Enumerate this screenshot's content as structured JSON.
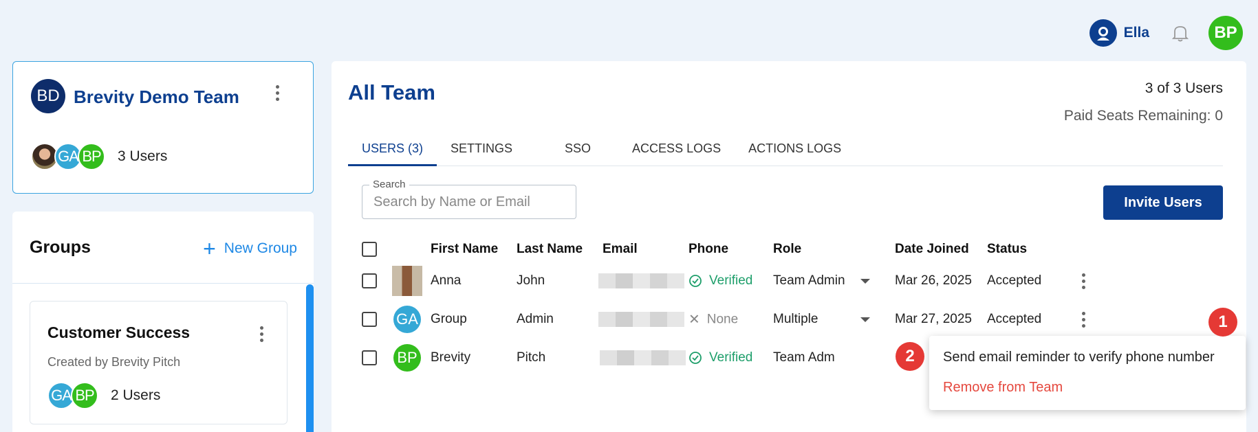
{
  "topbar": {
    "assistant_name": "Ella",
    "user_initials": "BP"
  },
  "team": {
    "initials": "BD",
    "name": "Brevity Demo Team",
    "member_avatars": [
      "GA",
      "BP"
    ],
    "users_label": "3 Users"
  },
  "groups": {
    "title": "Groups",
    "new_group_label": "New Group",
    "items": [
      {
        "name": "Customer Success",
        "created_by": "Created by Brevity Pitch",
        "member_avatars": [
          "GA",
          "BP"
        ],
        "users_label": "2 Users"
      }
    ]
  },
  "main": {
    "title": "All Team",
    "user_count": "3 of 3 Users",
    "seats_remaining": "Paid Seats Remaining: 0",
    "tabs": [
      "USERS (3)",
      "SETTINGS",
      "SSO",
      "ACCESS LOGS",
      "ACTIONS LOGS"
    ],
    "active_tab": "USERS (3)",
    "search": {
      "label": "Search",
      "placeholder": "Search by Name or Email"
    },
    "invite_button": "Invite Users",
    "columns": [
      "First Name",
      "Last Name",
      "Email",
      "Phone",
      "Role",
      "Date Joined",
      "Status"
    ],
    "rows": [
      {
        "avatar": "",
        "first": "Anna",
        "last": "John",
        "phone": "Verified",
        "role": "Team Admin",
        "joined": "Mar 26, 2025",
        "status": "Accepted"
      },
      {
        "avatar": "GA",
        "first": "Group",
        "last": "Admin",
        "phone": "None",
        "role": "Multiple",
        "joined": "Mar 27, 2025",
        "status": "Accepted"
      },
      {
        "avatar": "BP",
        "first": "Brevity",
        "last": "Pitch",
        "phone": "Verified",
        "role": "Team Adm",
        "joined": "",
        "status": ""
      }
    ]
  },
  "context_menu": {
    "items": [
      "Send email reminder to verify phone number",
      "Remove from Team"
    ]
  },
  "markers": [
    "1",
    "2"
  ],
  "colors": {
    "brand_navy": "#0d3f8f",
    "accent_blue": "#1e88e5",
    "verified_green": "#1d9e6a",
    "danger_red": "#e5483e",
    "avatar_green": "#33bd1c",
    "avatar_teal": "#35a8d6"
  }
}
